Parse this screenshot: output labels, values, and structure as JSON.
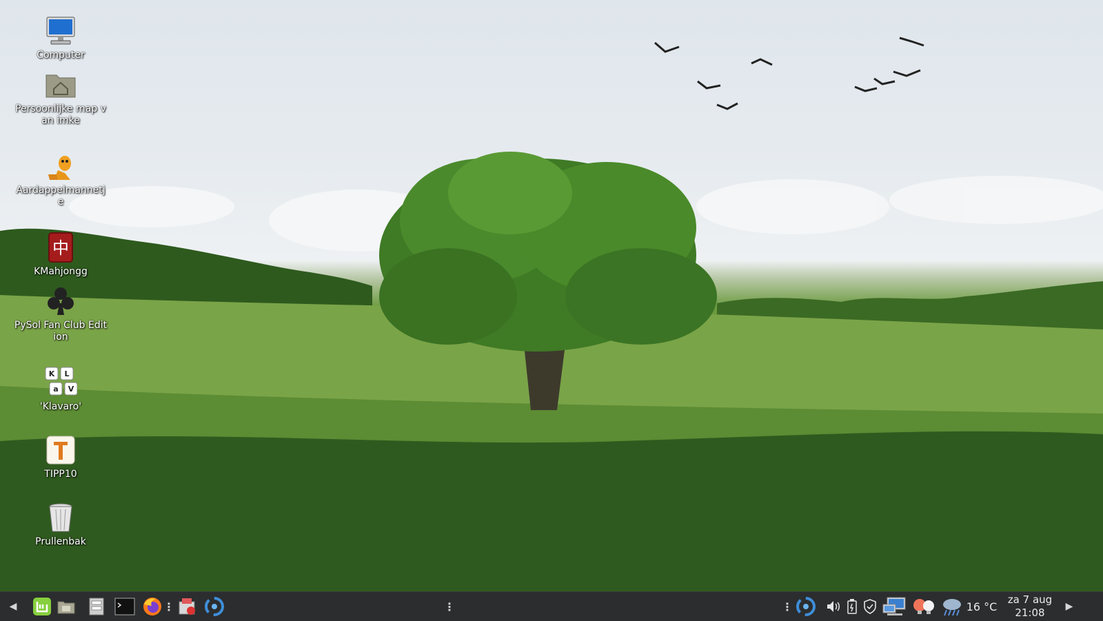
{
  "desktop_icons": [
    {
      "label": "Computer",
      "icon": "computer-icon"
    },
    {
      "label": "Persoonlijke map van imke",
      "icon": "home-folder-icon"
    },
    {
      "label": "Aardappelmannetje",
      "icon": "potato-guy-icon"
    },
    {
      "label": "KMahjongg",
      "icon": "mahjongg-tile-icon"
    },
    {
      "label": "PySol Fan Club Edition",
      "icon": "club-suit-icon"
    },
    {
      "label": "'Klavaro'",
      "icon": "keyboard-keys-icon"
    },
    {
      "label": "TIPP10",
      "icon": "tipp10-icon"
    },
    {
      "label": "Prullenbak",
      "icon": "trash-icon"
    }
  ],
  "taskbar": {
    "launchers": [
      "mint-menu-icon",
      "show-desktop-icon",
      "file-manager-icon",
      "terminal-icon",
      "firefox-icon",
      "software-manager-icon",
      "steam-like-icon"
    ],
    "tray": [
      "steam-like-icon",
      "volume-icon",
      "battery-icon",
      "shield-icon",
      "network-icon",
      "redshift-icon",
      "weather-icon"
    ],
    "temperature": "16 °C",
    "date": "za 7 aug",
    "time": "21:08"
  },
  "colors": {
    "taskbar_bg": "#2b2d2f",
    "mint_green": "#87cf3e"
  }
}
